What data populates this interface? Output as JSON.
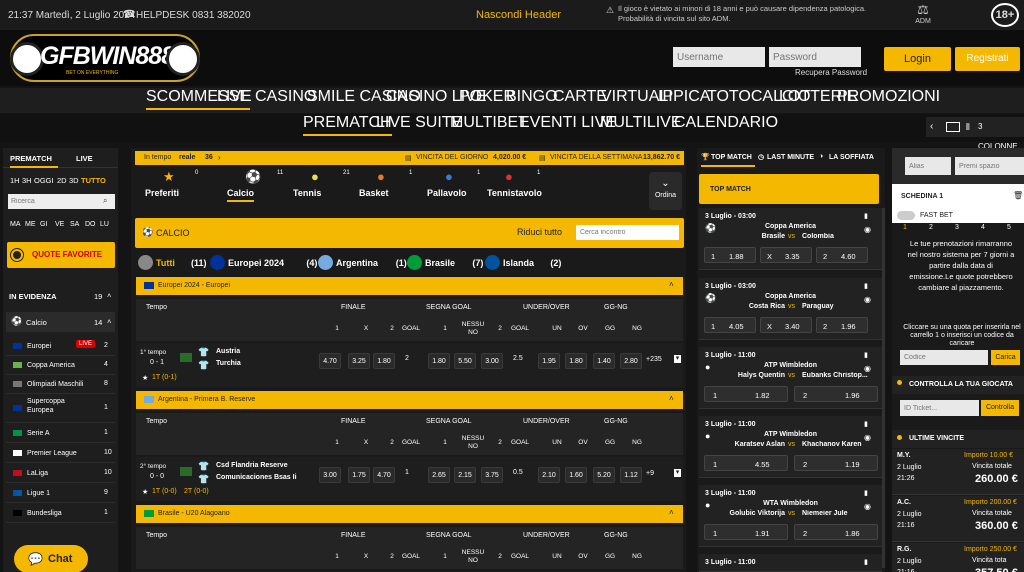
{
  "topbar": {
    "datetime": "21:37 Martedì, 2 Luglio 2024",
    "helpdesk": "HELPDESK 0831 382020",
    "hide_header": "Nascondi Header",
    "warning": "Il gioco è vietato ai minori di 18 anni e può causare dipendenza patologica. Probabilità di vincita sul sito ADM.",
    "adm": "ADM",
    "age": "18+"
  },
  "header": {
    "logo_text": "GFBWIN888",
    "logo_slogan": "BET ON EVERYTHING",
    "username_ph": "Username",
    "password_ph": "Password",
    "recupera": "Recupera Password",
    "login": "Login",
    "registrati": "Registrati"
  },
  "nav_main": [
    "SCOMMESSE",
    "LIVE",
    "CASINO",
    "SMILE CASINO",
    "CASINO LIVE",
    "POKER",
    "BINGO",
    "CARTE",
    "VIRTUALI",
    "IPPICA",
    "TOTOCALCIO",
    "LOTTERIE",
    "PROMOZIONI"
  ],
  "nav_sub": [
    "PREMATCH",
    "LIVE SUITE",
    "MULTIBET",
    "EVENTI LIVE",
    "MULTILIVE",
    "CALENDARIO"
  ],
  "columns_label": "3 COLONNE",
  "left": {
    "tab1": "PREMATCH",
    "tab2": "LIVE",
    "times": [
      "1H",
      "3H",
      "OGGI",
      "2D",
      "3D",
      "TUTTO"
    ],
    "search_ph": "Ricerca",
    "days": [
      "MA",
      "ME",
      "GI",
      "VE",
      "SA",
      "DO",
      "LU"
    ],
    "fav": "QUOTE FAVORITE",
    "evidenza": "IN EVIDENZA",
    "evidenza_count": "19",
    "sport": "Calcio",
    "sport_count": "14",
    "items": [
      {
        "name": "Europei",
        "badge": "LIVE",
        "count": "2"
      },
      {
        "name": "Coppa America",
        "count": "4"
      },
      {
        "name": "Olimpiadi Maschili",
        "count": "8"
      },
      {
        "name": "Supercoppa Europea",
        "count": "1"
      },
      {
        "name": "Serie A",
        "count": "1"
      },
      {
        "name": "Premier League",
        "count": "10"
      },
      {
        "name": "LaLiga",
        "count": "10"
      },
      {
        "name": "Ligue 1",
        "count": "9"
      },
      {
        "name": "Bundesliga",
        "count": "1"
      }
    ]
  },
  "center": {
    "in_tempo": "In tempo",
    "reale": "reale",
    "reale_count": "36",
    "vincita_giorno": "VINCITA DEL GIORNO",
    "vincita_giorno_val": "4,020.00 €",
    "vincita_settimana": "VINCITA DELLA SETTIMANA",
    "vincita_settimana_val": "13,862.70 €",
    "sports": [
      {
        "name": "Preferiti",
        "count": "0"
      },
      {
        "name": "Calcio",
        "count": "11"
      },
      {
        "name": "Tennis",
        "count": "21"
      },
      {
        "name": "Basket",
        "count": "1"
      },
      {
        "name": "Pallavolo",
        "count": "1"
      },
      {
        "name": "Tennistavolo",
        "count": "1"
      }
    ],
    "ordina": "Ordina",
    "section": "CALCIO",
    "riduci": "Riduci tutto",
    "cerca_ph": "Cerca incontro",
    "filters": [
      {
        "name": "Tutti",
        "count": "(11)"
      },
      {
        "name": "Europei 2024",
        "count": "(4)"
      },
      {
        "name": "Argentina",
        "count": "(1)"
      },
      {
        "name": "Brasile",
        "count": "(7)"
      },
      {
        "name": "Islanda",
        "count": "(2)"
      }
    ],
    "groups": [
      {
        "title": "Europei 2024 - Europei",
        "time": "1° tempo",
        "score": "0 - 1",
        "t1": "Austria",
        "t2": "Turchia",
        "ind": "1T (0-1)",
        "odds": [
          "4.70",
          "3.25",
          "1.80",
          "2",
          "1.80",
          "5.50",
          "3.00",
          "2.5",
          "1.95",
          "1.80",
          "1.40",
          "2.80"
        ],
        "more": "+235"
      },
      {
        "title": "Argentina - Primera B. Reserve",
        "time": "2° tempo",
        "score": "0 - 0",
        "t1": "Csd Flandria Reserve",
        "t2": "Comunicaciones Bsas Ii",
        "ind": "1T (0-0)",
        "ind2": "2T (0-0)",
        "odds": [
          "3.00",
          "1.75",
          "4.70",
          "1",
          "2.65",
          "2.15",
          "3.75",
          "0.5",
          "2.10",
          "1.60",
          "5.20",
          "1.12"
        ],
        "more": "+9"
      },
      {
        "title": "Brasile - U20 Alagoano"
      }
    ],
    "hdr": {
      "tempo": "Tempo",
      "finale": "FINALE",
      "segna": "SEGNA GOAL",
      "under": "UNDER/OVER",
      "gg": "GG-NG",
      "sub": [
        "1",
        "X",
        "2",
        "GOAL",
        "1",
        "NESSU NO",
        "2",
        "GOAL",
        "UN",
        "OV",
        "GG",
        "NG"
      ]
    }
  },
  "right": {
    "tab1": "TOP MATCH",
    "tab2": "LAST MINUTE",
    "tab3": "LA SOFFIATA",
    "header": "TOP MATCH",
    "matches": [
      {
        "date": "3 Luglio - 03:00",
        "comp": "Coppa America",
        "t1": "Brasile",
        "t2": "Colombia",
        "o": [
          "1",
          "1.88",
          "X",
          "3.35",
          "2",
          "4.60"
        ]
      },
      {
        "date": "3 Luglio - 03:00",
        "comp": "Coppa America",
        "t1": "Costa Rica",
        "t2": "Paraguay",
        "o": [
          "1",
          "4.05",
          "X",
          "3.40",
          "2",
          "1.96"
        ]
      },
      {
        "date": "3 Luglio - 11:00",
        "comp": "ATP Wimbledon",
        "t1": "Halys Quentin",
        "t2": "Eubanks Christop...",
        "o": [
          "1",
          "1.82",
          "2",
          "1.96"
        ]
      },
      {
        "date": "3 Luglio - 11:00",
        "comp": "ATP Wimbledon",
        "t1": "Karatsev Aslan",
        "t2": "Khachanov Karen",
        "o": [
          "1",
          "4.55",
          "2",
          "1.19"
        ]
      },
      {
        "date": "3 Luglio - 11:00",
        "comp": "WTA Wimbledon",
        "t1": "Golubic Viktorija",
        "t2": "Niemeier Jule",
        "o": [
          "1",
          "1.91",
          "2",
          "1.86"
        ]
      },
      {
        "date": "3 Luglio - 11:00"
      }
    ],
    "vs": "vs"
  },
  "far": {
    "alias_ph": "Alias",
    "premi_ph": "Premi spazio",
    "schedina": "SCHEDINA 1",
    "fast": "FAST BET",
    "nums": [
      "1",
      "2",
      "3",
      "4",
      "5"
    ],
    "msg": "Le tue prenotazioni rimarranno nel nostro sistema per 7 giorni a partire dalla data di emissione.Le quote potrebbero cambiare al piazzamento.",
    "msg2": "Cliccare su una quota per inserirla nel carrello 1 o inserisci un codice da caricare",
    "codice_ph": "Codice",
    "carica": "Carica",
    "controlla": "CONTROLLA LA TUA GIOCATA",
    "ticket_ph": "ID Ticket...",
    "controlla_btn": "Controlla",
    "ultime": "ULTIME VINCITE",
    "wins": [
      {
        "user": "M.Y.",
        "date": "2 Luglio",
        "time": "21:26",
        "imp": "Importo 10.00 €",
        "vl": "Vincita totale",
        "val": "260.00 €"
      },
      {
        "user": "A.C.",
        "date": "2 Luglio",
        "time": "21:16",
        "imp": "Importo 200.00 €",
        "vl": "Vincita totale",
        "val": "360.00 €"
      },
      {
        "user": "R.G.",
        "date": "2 Luglio",
        "time": "21:16",
        "imp": "Importo 250.00 €",
        "vl": "Vincita tota",
        "val": "357.50 €"
      }
    ]
  },
  "chat": "Chat"
}
